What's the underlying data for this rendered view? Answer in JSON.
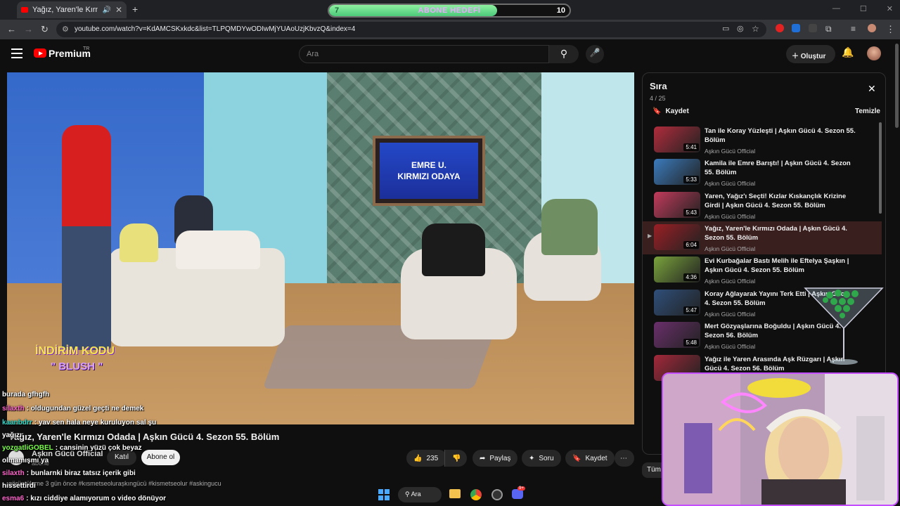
{
  "browser": {
    "tab_title": "Yağız, Yaren'le Kırmızı Odad",
    "tab_close": "✕",
    "new_tab": "+",
    "url": "youtube.com/watch?v=KdAMCSKxkdc&list=TLPQMDYwODIwMjYUAoUzjKbvzQ&index=4",
    "window_controls": [
      "—",
      "☐",
      "✕"
    ]
  },
  "goal_bar": {
    "label": "ABONE HEDEFİ",
    "current": "7",
    "target": "10",
    "progress_fraction": 0.7
  },
  "youtube": {
    "brand": "Premium",
    "region": "TR",
    "search_placeholder": "Ara",
    "create_label": "Oluştur"
  },
  "video": {
    "tv_line1": "EMRE U.",
    "tv_line2": "KIRMIZI ODAYA",
    "promo_line1": "İNDİRİM KODU",
    "promo_line2": "\" BLUSH \"",
    "title": "Yağız, Yaren'le Kırmızı Odada | Aşkın Gücü 4. Sezon 55. Bölüm",
    "channel": "Aşkın Gücü Official",
    "subs": "abone",
    "join_label": "Katıl",
    "subscribe_label": "Abone ol",
    "likes": "235",
    "share_label": "Paylaş",
    "ask_label": "Soru",
    "save_label": "Kaydet",
    "description": "görüntüleme  3 gün önce  #kısmetseolurașkıngücü #kismetseolur #askingucu"
  },
  "queue": {
    "title": "Sıra",
    "count": "4 / 25",
    "save_label": "Kaydet",
    "clear_label": "Temizle",
    "items": [
      {
        "title": "Tan ile Koray Yüzleşti | Aşkın Gücü 4. Sezon 55. Bölüm",
        "channel": "Aşkın Gücü Official",
        "duration": "5:41",
        "color": "#b02c3c"
      },
      {
        "title": "Kamila ile Emre Barıştı! | Aşkın Gücü 4. Sezon 55. Bölüm",
        "channel": "Aşkın Gücü Official",
        "duration": "5:33",
        "color": "#3b7bbd"
      },
      {
        "title": "Yaren, Yağız'ı Seçti! Kızlar Kıskançlık Krizine Girdi | Aşkın Gücü 4. Sezon 55. Bölüm",
        "channel": "Aşkın Gücü Official",
        "duration": "5:43",
        "color": "#c23b5c"
      },
      {
        "title": "Yağız, Yaren'le Kırmızı Odada | Aşkın Gücü 4. Sezon 55. Bölüm",
        "channel": "Aşkın Gücü Official",
        "duration": "6:04",
        "color": "#9a1f25"
      },
      {
        "title": "Evi Kurbağalar Bastı Melih ile Eftelya Şaşkın | Aşkın Gücü 4. Sezon 55. Bölüm",
        "channel": "Aşkın Gücü Official",
        "duration": "4:36",
        "color": "#7aa33c"
      },
      {
        "title": "Koray Ağlayarak Yayını Terk Etti | Aşkın Gücü 4. Sezon 55. Bölüm",
        "channel": "Aşkın Gücü Official",
        "duration": "5:47",
        "color": "#2f4f7a"
      },
      {
        "title": "Mert Gözyaşlarına Boğuldu | Aşkın Gücü 4. Sezon 56. Bölüm",
        "channel": "Aşkın Gücü Official",
        "duration": "5:48",
        "color": "#6a2f6b"
      },
      {
        "title": "Yağız ile Yaren Arasında Aşk Rüzgarı | Aşkın Gücü 4. Sezon 56. Bölüm",
        "channel": "Aşkın Gücü Official",
        "duration": "",
        "color": "#a3283a"
      }
    ],
    "active_index": 3,
    "all_chip": "Tüm"
  },
  "chat": [
    {
      "user": "",
      "msg": "burada gfhgfh",
      "color": "#ffffff"
    },
    {
      "user": "silaxth",
      "msg": ": oldugundan güzel geçti ne demek",
      "color": "#ff66cc"
    },
    {
      "user": "kaanbdrr",
      "msg": ": yav sen hala neye kuruluyon sal şu",
      "color": "#2fd6c9"
    },
    {
      "user": "",
      "msg": "yağızı",
      "color": "#ffffff"
    },
    {
      "user": "yozgatliGOBEL",
      "msg": ": cansinin yüzü çok beyaz",
      "color": "#7dff4d"
    },
    {
      "user": "",
      "msg": "olmamışmı ya",
      "color": "#ffffff"
    },
    {
      "user": "silaxth",
      "msg": ": bunlarnki biraz tatsız içerik gibi",
      "color": "#ff66cc"
    },
    {
      "user": "",
      "msg": "hissettirdi",
      "color": "#ffffff"
    },
    {
      "user": "esma6",
      "msg": ": kızı ciddiye alamıyorum o video dönüyor",
      "color": "#ff66cc"
    }
  ],
  "taskbar": {
    "search_label": "Ara",
    "discord_badge": "9+"
  }
}
